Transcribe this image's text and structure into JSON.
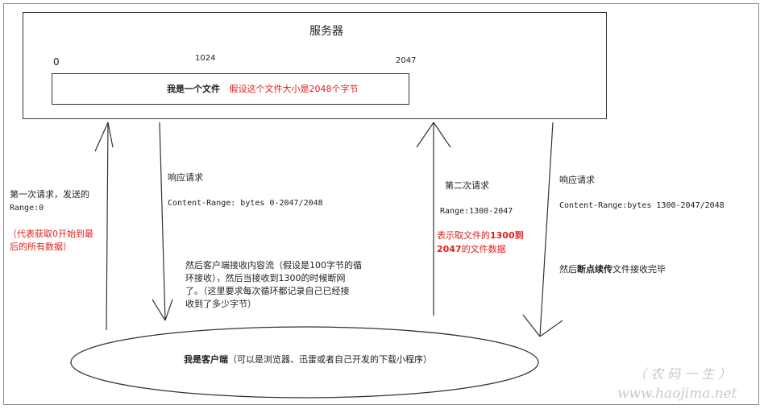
{
  "server": {
    "title": "服务器",
    "tick_start": "0",
    "tick_mid": "1024",
    "tick_end": "2047"
  },
  "file": {
    "label": "我是一个文件",
    "note": "假设这个文件大小是2048个字节"
  },
  "first_request": {
    "line1": "第一次请求，发送的",
    "line2": "Range:0",
    "note_line1": "（代表获取0开始到最",
    "note_line2": "后的所有数据）"
  },
  "first_response": {
    "title": "响应请求",
    "header": "Content-Range: bytes 0-2047/2048",
    "desc_line1": "然后客户端接收内容流（假设是100字节的循",
    "desc_line2": "环接收），然后当接收到1300的时候断网",
    "desc_line3": "了。（这里要求每次循环都记录自己已经接",
    "desc_line4": "收到了多少字节）"
  },
  "second_request": {
    "title": "第二次请求",
    "range": "Range:1300-2047",
    "note_line1_a": "表示取文件的",
    "note_line1_b": "1300到",
    "note_line2_a": "2047",
    "note_line2_b": "的文件数据"
  },
  "second_response": {
    "title": "响应请求",
    "header": "Content-Range:bytes 1300-2047/2048",
    "desc_a": "然后",
    "desc_b": "断点续传",
    "desc_c": "文件接收完毕"
  },
  "client": {
    "label": "我是客户端",
    "note": "（可以是浏览器、迅雷或者自己开发的下载小程序）"
  },
  "watermark": {
    "line1": "（ 农 码 一 生 ）",
    "line2": "www.haojima.net"
  }
}
